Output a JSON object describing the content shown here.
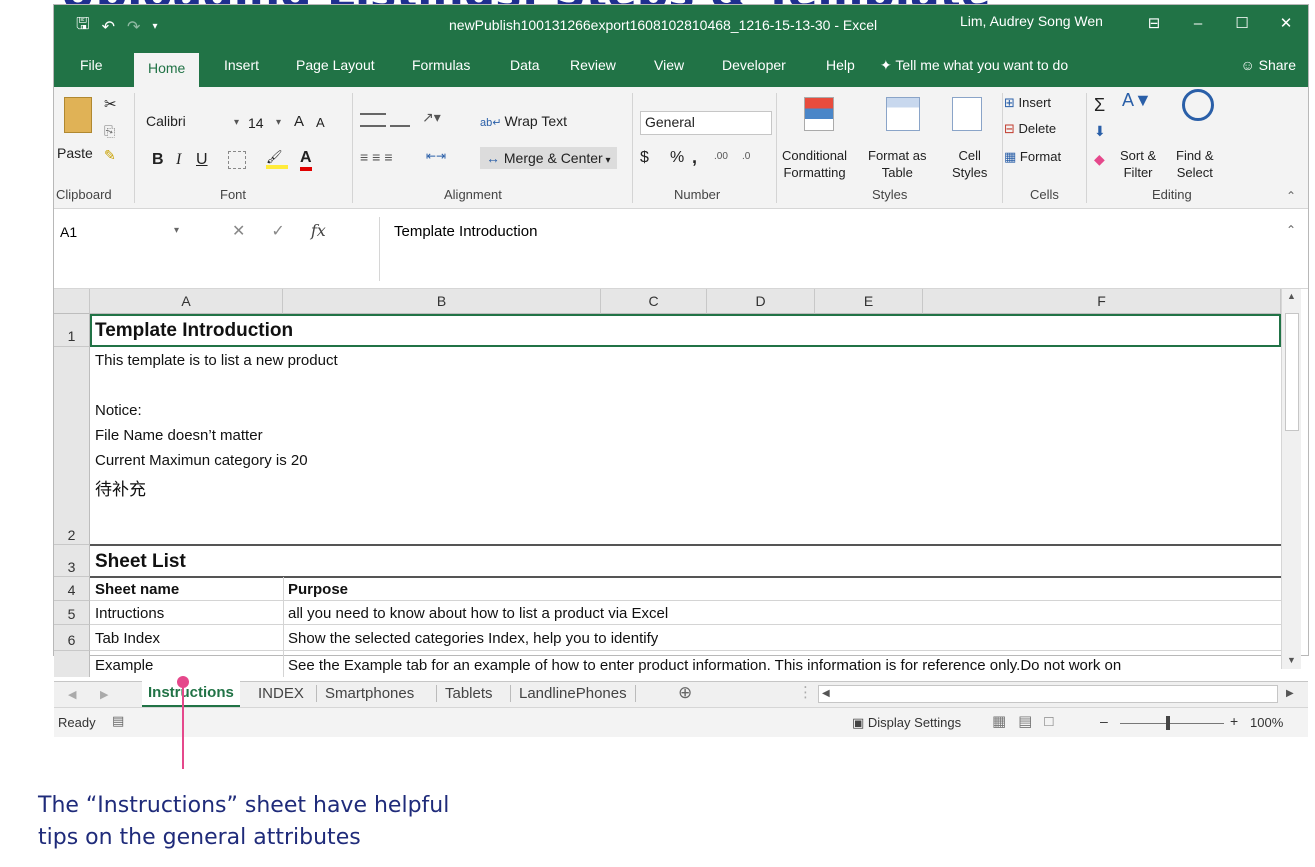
{
  "window": {
    "title": "newPublish100131266export1608102810468_1216-15-13-30  -  Excel",
    "user": "Lim, Audrey Song Wen",
    "controls": [
      "⊟",
      "–",
      "☐",
      "✕"
    ]
  },
  "ribbon_tabs": [
    {
      "label": "File"
    },
    {
      "label": "Home",
      "active": true
    },
    {
      "label": "Insert"
    },
    {
      "label": "Page Layout"
    },
    {
      "label": "Formulas"
    },
    {
      "label": "Data"
    },
    {
      "label": "Review"
    },
    {
      "label": "View"
    },
    {
      "label": "Developer"
    },
    {
      "label": "Help"
    },
    {
      "label": "Tell me what you want to do"
    }
  ],
  "share_label": "Share",
  "ribbon": {
    "clipboard": {
      "paste": "Paste",
      "group": "Clipboard"
    },
    "font": {
      "name": "Calibri",
      "size": "14",
      "bold": "B",
      "italic": "I",
      "underline": "U",
      "grow": "A",
      "shrink": "A",
      "color_a": "A",
      "group": "Font"
    },
    "alignment": {
      "wrap_text": "Wrap Text",
      "merge_center": "Merge & Center",
      "group": "Alignment"
    },
    "number": {
      "format": "General",
      "currency": "$",
      "percent": "%",
      "comma": ",",
      "increase_decimal": ".00",
      "decrease_decimal": ".0",
      "group": "Number"
    },
    "styles": {
      "conditional": "Conditional",
      "conditional_sub": "Formatting",
      "format_table": "Format as",
      "format_table_sub": "Table",
      "cell_styles": "Cell",
      "cell_styles_sub": "Styles",
      "group": "Styles"
    },
    "cells": {
      "insert": "Insert",
      "delete": "Delete",
      "format": "Format",
      "group": "Cells"
    },
    "editing": {
      "sum": "Σ",
      "sort_filter": "Sort &",
      "sort_filter_sub": "Filter",
      "find_select": "Find &",
      "find_select_sub": "Select",
      "group": "Editing"
    }
  },
  "formula_bar": {
    "name_box": "A1",
    "content": "Template Introduction",
    "fx": "fx"
  },
  "columns": [
    "A",
    "B",
    "C",
    "D",
    "E",
    "F"
  ],
  "rows": [
    {
      "num": "1",
      "a": "Template Introduction",
      "b": ""
    },
    {
      "num": "2",
      "lines": [
        "This template is to list a new product",
        "",
        "Notice:",
        "File Name doesn’t matter",
        "Current Maximun category is 20",
        "待补充"
      ]
    },
    {
      "num": "3",
      "a": "Sheet List",
      "b": ""
    },
    {
      "num": "4",
      "a": "Sheet name",
      "b": "Purpose"
    },
    {
      "num": "5",
      "a": "Intructions",
      "b": "all you need to know about how to list a product via Excel"
    },
    {
      "num": "6",
      "a": "Tab Index",
      "b": "Show the selected categories Index, help you to identify"
    },
    {
      "num": "",
      "a": "Example",
      "b": "See the Example tab for an example of how to enter product information. This information is for reference only.Do not work on"
    }
  ],
  "sheet_tabs": [
    {
      "label": "Instructions",
      "active": true
    },
    {
      "label": "INDEX"
    },
    {
      "label": "Smartphones"
    },
    {
      "label": "Tablets"
    },
    {
      "label": "LandlinePhones"
    }
  ],
  "status": {
    "ready": "Ready",
    "display_settings": "Display Settings",
    "zoom": "100%"
  },
  "callout": {
    "line1": "The “Instructions” sheet have helpful",
    "line2": "tips on the general attributes"
  },
  "colors": {
    "excel_green": "#217346",
    "callout_pink": "#e5488b",
    "callout_text": "#1f2b7a"
  }
}
